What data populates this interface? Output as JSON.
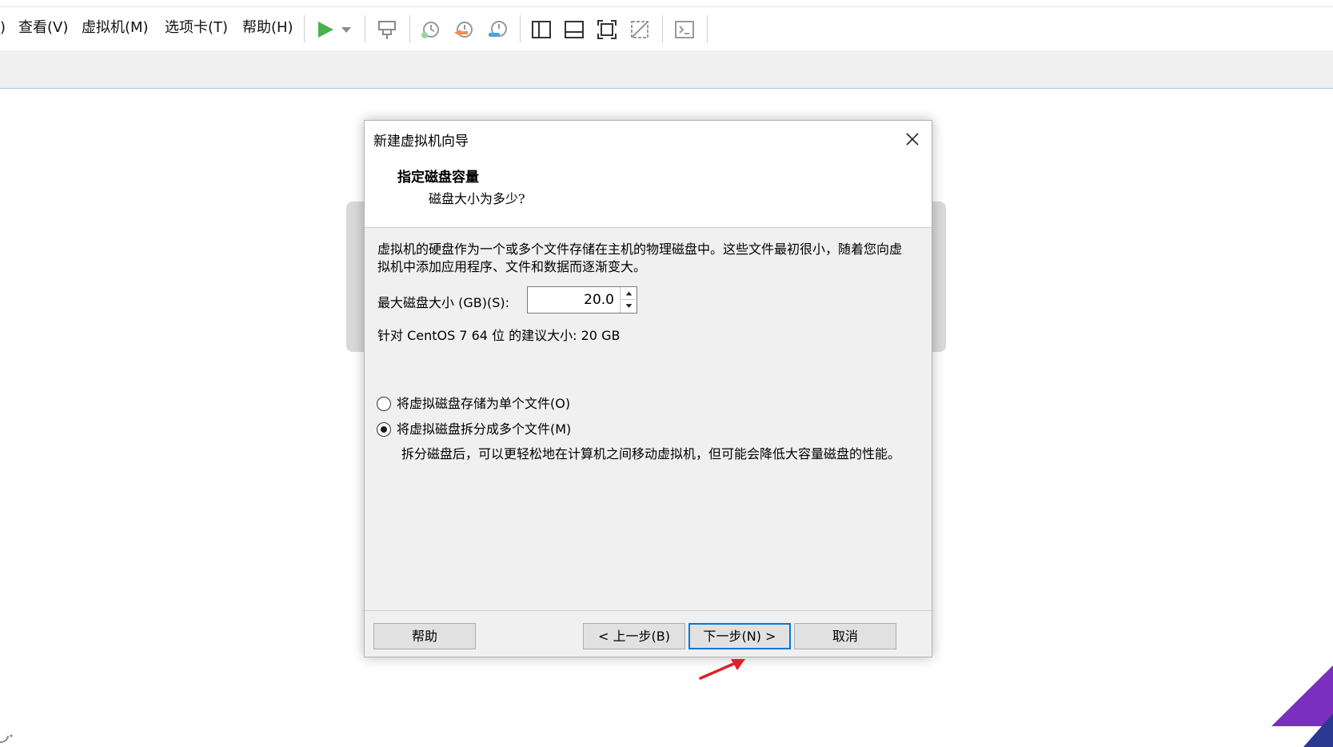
{
  "menu": {
    "items": [
      {
        "label": ")"
      },
      {
        "label": "查看(V)"
      },
      {
        "label": "虚拟机(M)"
      },
      {
        "label": "选项卡(T)"
      },
      {
        "label": "帮助(H)"
      }
    ]
  },
  "toolbar": {
    "icons": [
      "play-icon",
      "dropdown-arrow-icon",
      "send-keys-icon",
      "snapshot-take-icon",
      "snapshot-revert-icon",
      "snapshot-manager-icon",
      "sidebar-toggle-icon",
      "thumbnail-bar-icon",
      "full-screen-icon",
      "unity-icon",
      "console-view-icon"
    ],
    "accent_play": "#4caf50"
  },
  "dialog": {
    "title": "新建虚拟机向导",
    "heading": "指定磁盘容量",
    "subheading": "磁盘大小为多少?",
    "description": "虚拟机的硬盘作为一个或多个文件存储在主机的物理磁盘中。这些文件最初很小，随着您向虚拟机中添加应用程序、文件和数据而逐渐变大。",
    "max_size_label": "最大磁盘大小 (GB)(S):",
    "max_size_value": "20.0",
    "recommendation": "针对 CentOS 7 64 位 的建议大小: 20 GB",
    "radio_single_label": "将虚拟磁盘存储为单个文件(O)",
    "radio_split_label": "将虚拟磁盘拆分成多个文件(M)",
    "radio_selected": "split",
    "split_note": "拆分磁盘后，可以更轻松地在计算机之间移动虚拟机，但可能会降低大容量磁盘的性能。",
    "buttons": {
      "help": "帮助",
      "back": "< 上一步(B)",
      "next": "下一步(N) >",
      "cancel": "取消"
    },
    "accent_focus": "#0078d7"
  },
  "annotation": {
    "arrow_color": "#e0202a"
  },
  "corner_colors": [
    "#7b2fbe",
    "#2b3990"
  ]
}
